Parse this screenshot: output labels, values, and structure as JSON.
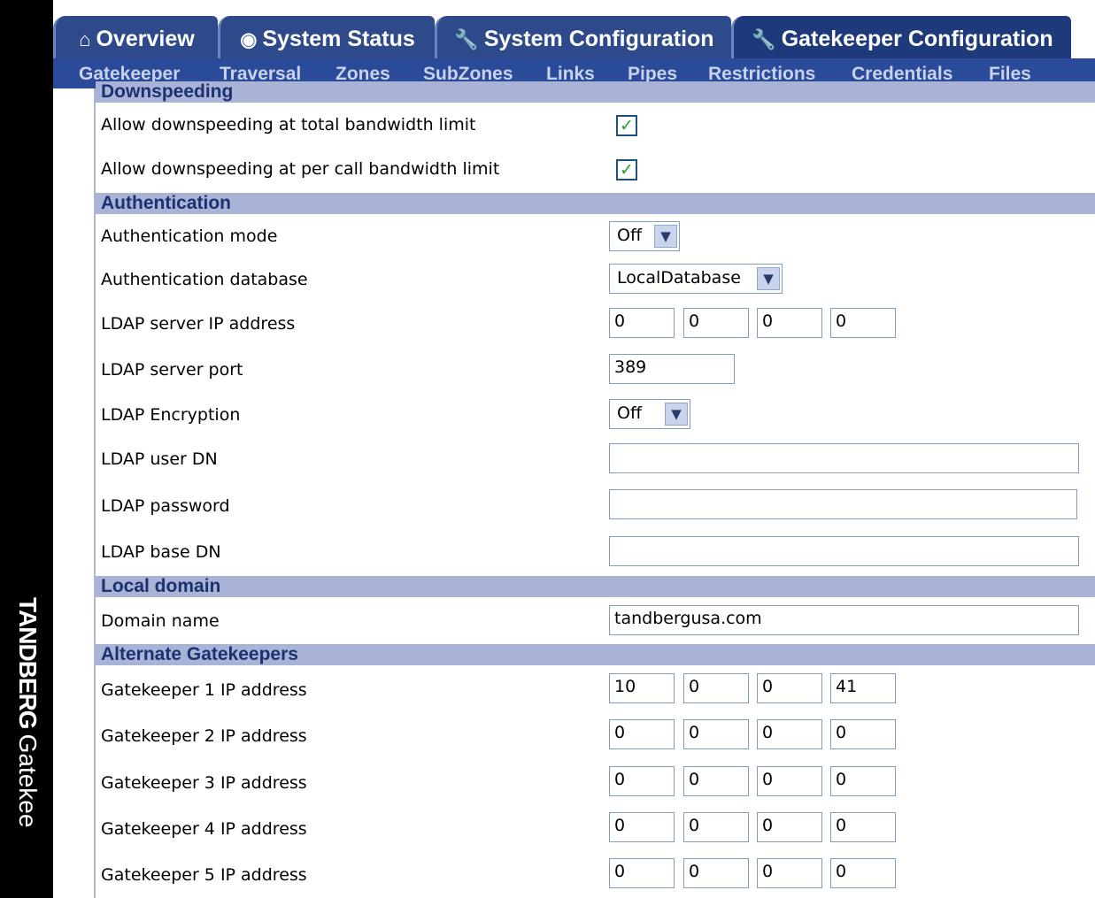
{
  "brand": {
    "name": "TANDBERG",
    "product": "Gatekee"
  },
  "tabs": [
    {
      "label": "Overview",
      "icon": "overview-icon",
      "glyph": "⌂"
    },
    {
      "label": "System Status",
      "icon": "status-icon",
      "glyph": "◉"
    },
    {
      "label": "System Configuration",
      "icon": "wrench-icon",
      "glyph": "🔧"
    },
    {
      "label": "Gatekeeper Configuration",
      "icon": "wrench-icon",
      "glyph": "🔧"
    }
  ],
  "subnav": [
    "Gatekeeper",
    "Traversal",
    "Zones",
    "SubZones",
    "Links",
    "Pipes",
    "Restrictions",
    "Credentials",
    "Files"
  ],
  "sections": {
    "downspeeding": "Downspeeding",
    "authentication": "Authentication",
    "local_domain": "Local domain",
    "alternate": "Alternate Gatekeepers"
  },
  "fields": {
    "downspeed_total": {
      "label": "Allow downspeeding at total bandwidth limit",
      "checked": true
    },
    "downspeed_call": {
      "label": "Allow downspeeding at per call bandwidth limit",
      "checked": true
    },
    "auth_mode": {
      "label": "Authentication mode",
      "value": "Off"
    },
    "auth_db": {
      "label": "Authentication database",
      "value": "LocalDatabase"
    },
    "ldap_ip": {
      "label": "LDAP server IP address",
      "octets": [
        "0",
        "0",
        "0",
        "0"
      ]
    },
    "ldap_port": {
      "label": "LDAP server port",
      "value": "389"
    },
    "ldap_enc": {
      "label": "LDAP Encryption",
      "value": "Off"
    },
    "ldap_user": {
      "label": "LDAP user DN",
      "value": ""
    },
    "ldap_pass": {
      "label": "LDAP password",
      "value": ""
    },
    "ldap_base": {
      "label": "LDAP base DN",
      "value": ""
    },
    "domain": {
      "label": "Domain name",
      "value": "tandbergusa.com"
    },
    "gk1": {
      "label": "Gatekeeper 1 IP address",
      "octets": [
        "10",
        "0",
        "0",
        "41"
      ]
    },
    "gk2": {
      "label": "Gatekeeper 2 IP address",
      "octets": [
        "0",
        "0",
        "0",
        "0"
      ]
    },
    "gk3": {
      "label": "Gatekeeper 3 IP address",
      "octets": [
        "0",
        "0",
        "0",
        "0"
      ]
    },
    "gk4": {
      "label": "Gatekeeper 4 IP address",
      "octets": [
        "0",
        "0",
        "0",
        "0"
      ]
    },
    "gk5": {
      "label": "Gatekeeper 5 IP address",
      "octets": [
        "0",
        "0",
        "0",
        "0"
      ]
    }
  },
  "colors": {
    "sidebar": "#000000",
    "tab": "#2e4a8a",
    "subnav": "#2a4a9a",
    "section": "#a9b3d5",
    "section_text": "#1d3072"
  }
}
